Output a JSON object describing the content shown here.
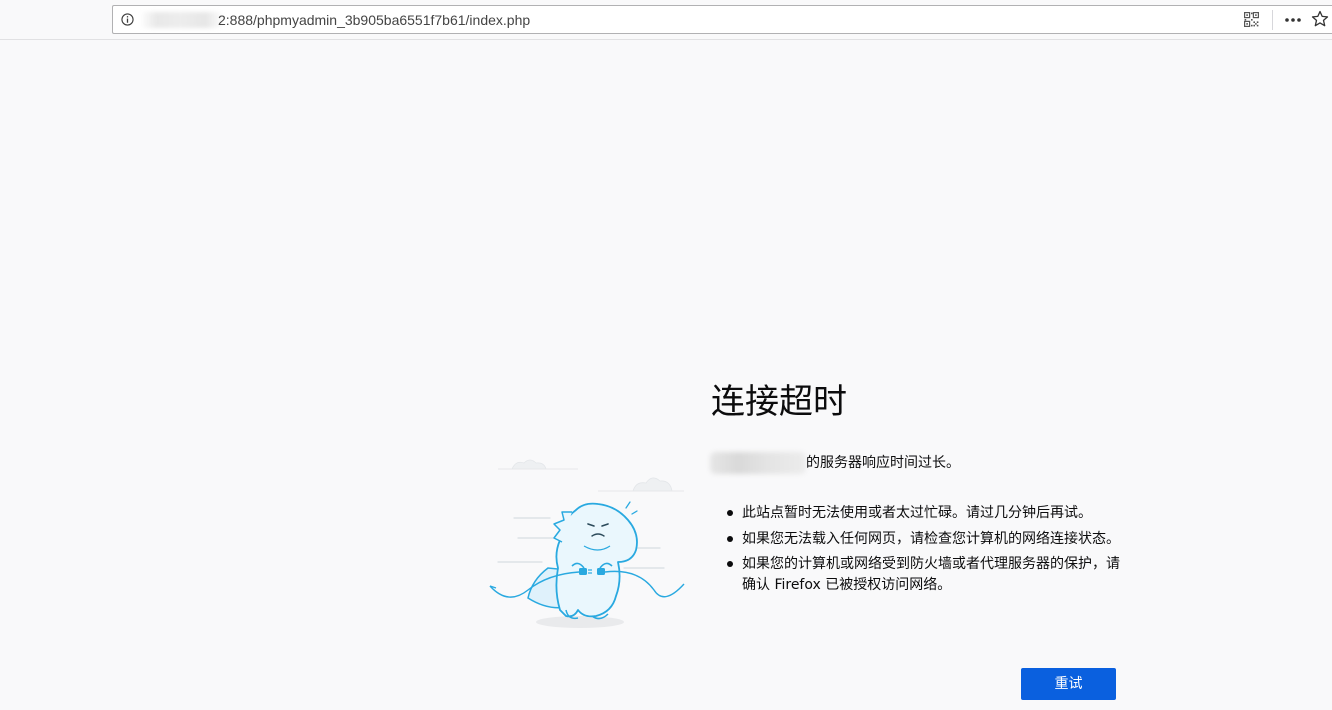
{
  "browser": {
    "url_text": "2:888/phpmyadmin_3b905ba6551f7b61/index.php"
  },
  "error_page": {
    "title": "连接超时",
    "description": "的服务器响应时间过长。",
    "reasons": [
      "此站点暂时无法使用或者太过忙碌。请过几分钟后再试。",
      "如果您无法载入任何网页，请检查您计算机的网络连接状态。",
      "如果您的计算机或网络受到防火墙或者代理服务器的保护，请确认 Firefox 已被授权访问网络。"
    ],
    "retry_label": "重试"
  },
  "icons": {
    "info": "info-icon",
    "qr": "qr-code-icon",
    "more": "more-actions-icon",
    "bookmark": "bookmark-star-icon",
    "illustration": "sad-dinosaur-unplugged-illustration"
  },
  "colors": {
    "page_background": "#f9f9fa",
    "primary_button": "#0a60df",
    "illustration_stroke": "#29a9e0",
    "illustration_fill": "#e9f6fd"
  }
}
